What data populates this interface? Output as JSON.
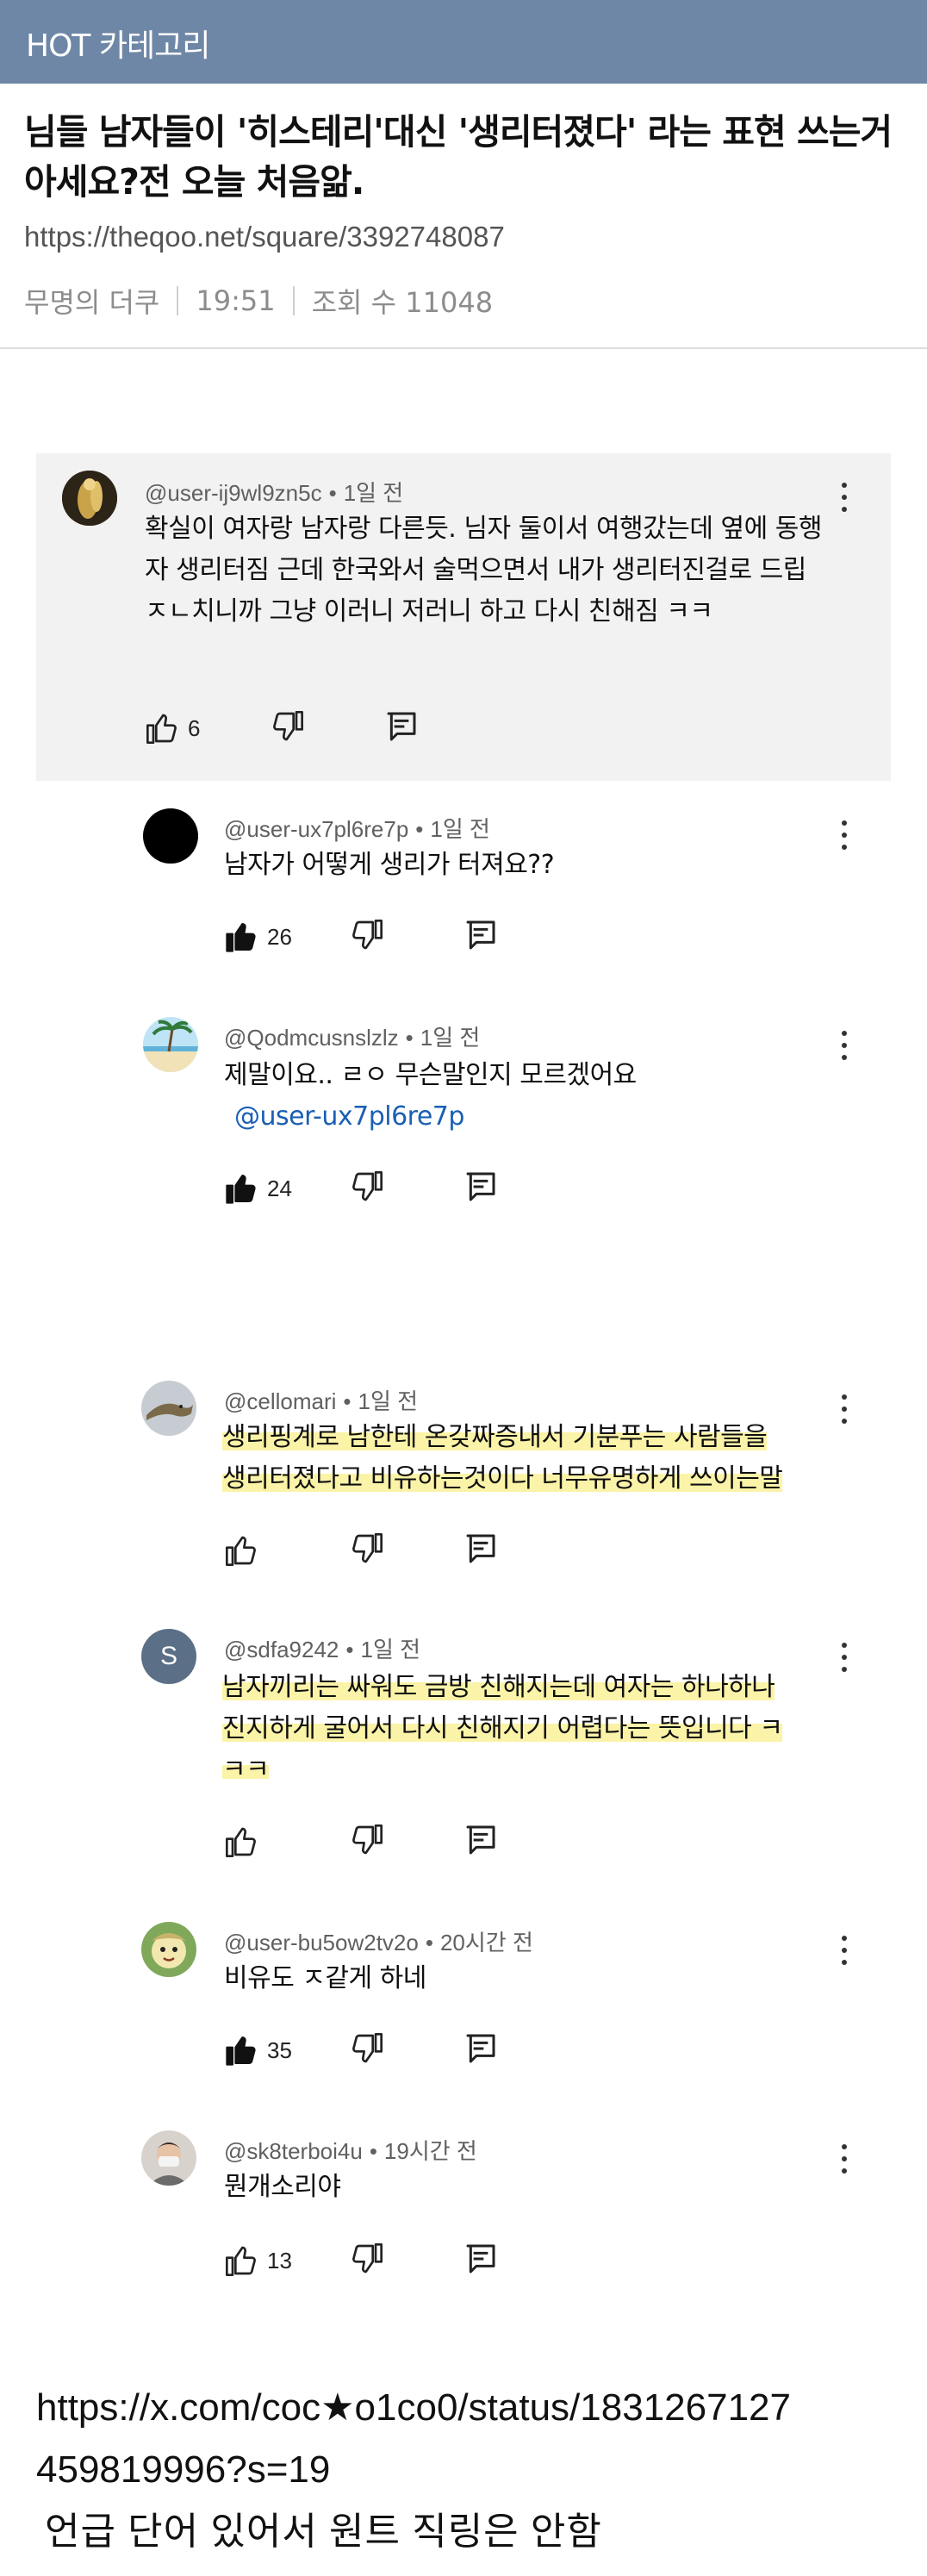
{
  "header": {
    "title": "HOT 카테고리",
    "bar_color": "#6e87a6"
  },
  "post": {
    "title": "님들 남자들이 '히스테리'대신 '생리터졌다' 라는 표현 쓰는거 아세요?전 오늘 처음앎.",
    "url": "https://theqoo.net/square/3392748087",
    "author": "무명의 더쿠",
    "time": "19:51",
    "views_label": "조회 수 11048"
  },
  "comments": [
    {
      "user": "@user-ij9wl9zn5c",
      "time": "1일 전",
      "text": "확실이 여자랑 남자랑 다른듯. 님자 둘이서 여행갔는데 옆에 동행자 생리터짐 근데 한국와서 술먹으면서 내가 생리터진걸로 드립 ㅈㄴ치니까 그냥 이러니 저러니 하고 다시 친해짐 ㅋㅋ",
      "likes": "6",
      "liked": false,
      "avatar": "gold-figure"
    },
    {
      "user": "@user-ux7pl6re7p",
      "time": "1일 전",
      "text": "남자가 어떻게 생리가 터져요??",
      "likes": "26",
      "liked": true,
      "avatar": "black-circle"
    },
    {
      "user": "@Qodmcusnslzlz",
      "time": "1일 전",
      "text": "제말이요.. ㄹㅇ 무슨말인지 모르겠어요",
      "mention": "@user-ux7pl6re7p",
      "likes": "24",
      "liked": true,
      "avatar": "beach-palm"
    },
    {
      "user": "@cellomari",
      "time": "1일 전",
      "text_line1": "생리핑계로 남한테 온갖짜증내서 기분푸는 사람들을",
      "text_line2": "생리터졌다고 비유하는것이다 너무유명하게 쓰이는말",
      "likes": "",
      "liked": false,
      "avatar": "lizard"
    },
    {
      "user": "@sdfa9242",
      "time": "1일 전",
      "text_line1": "남자끼리는 싸워도 금방 친해지는데 여자는 하나하나",
      "text_line2": "진지하게 굴어서 다시 친해지기 어렵다는 뜻입니다 ㅋ",
      "text_line3": "ㅋㅋ",
      "likes": "",
      "liked": false,
      "avatar_letter": "S",
      "avatar": "letter-s"
    },
    {
      "user": "@user-bu5ow2tv2o",
      "time": "20시간 전",
      "text": "비유도 ㅈ같게 하네",
      "likes": "35",
      "liked": true,
      "avatar": "cartoon-face"
    },
    {
      "user": "@sk8terboi4u",
      "time": "19시간 전",
      "text": "뭔개소리야",
      "likes": "13",
      "liked": false,
      "avatar": "photo-person"
    }
  ],
  "footer": {
    "link": "https://x.com/coc★o1co0/status/1831267127459819996?s=19",
    "link_line1": "https://x.com/coc★o1co0/status/1831267127",
    "link_line2": "459819996?s=19",
    "note": "언급 단어 있어서 원트 직링은 안함"
  }
}
